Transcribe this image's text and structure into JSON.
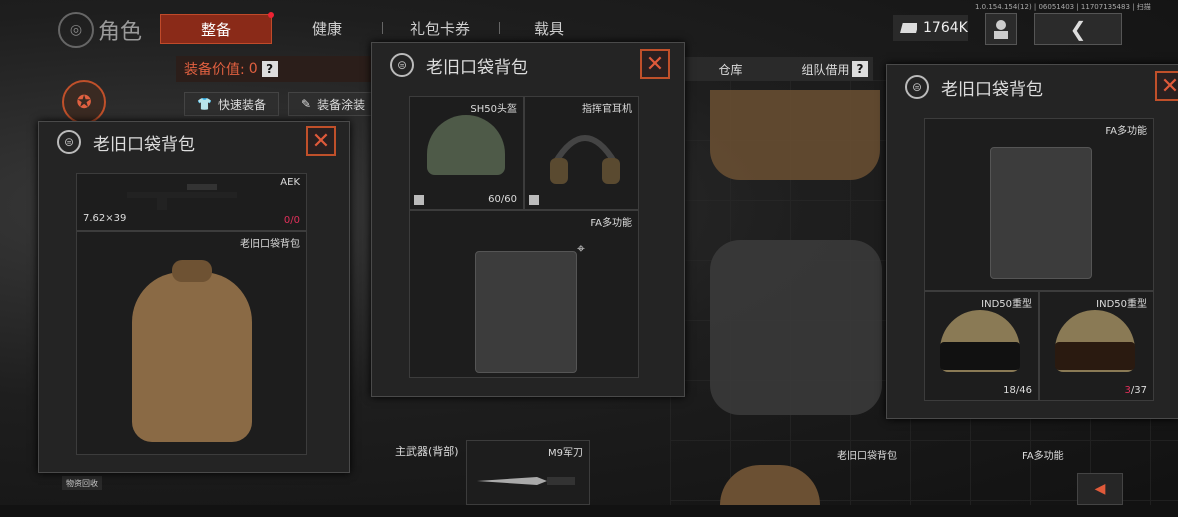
{
  "nav": {
    "title": "角色",
    "tabs": [
      {
        "label": "整备",
        "active": true
      },
      {
        "label": "健康",
        "active": false
      },
      {
        "label": "礼包卡券",
        "active": false
      },
      {
        "label": "载具",
        "active": false
      }
    ],
    "currency": "1764K",
    "build": "1.0.154.154(12) | 06051403 | 11707135483 | 扫描"
  },
  "toolbar": {
    "equip_value_label": "装备价值:",
    "equip_value": "0",
    "help": "?",
    "quick_equip": "快速装备",
    "skin": "装备涂装",
    "warehouse": "仓库",
    "team_borrow": "组队借用"
  },
  "panels": {
    "left": {
      "title": "老旧口袋背包",
      "weapon_name": "AEK",
      "ammo": "7.62×39",
      "ammo_count_current": "0",
      "ammo_count_total": "/0",
      "bag_name": "老旧口袋背包"
    },
    "middle": {
      "title": "老旧口袋背包",
      "helmet_name": "SH50头盔",
      "helmet_durability": "60/60",
      "headset_name": "指挥官耳机",
      "vest_name": "FA多功能"
    },
    "right": {
      "title": "老旧口袋背包",
      "vest_name": "FA多功能",
      "helmet1_name": "IND50重型",
      "helmet1_durability": "18/46",
      "helmet2_name": "IND50重型",
      "helmet2_durability_current": "3",
      "helmet2_durability_total": "/37"
    }
  },
  "bottom": {
    "recycle": "物资回收",
    "primary_weapon": "主武器(背部)",
    "knife": "M9军刀",
    "bag": "老旧口袋背包",
    "vest": "FA多功能"
  },
  "colors": {
    "accent": "#c0502a",
    "active_tab": "#8a2a18",
    "panel_bg": "#242424",
    "danger_text": "#e0305a"
  }
}
